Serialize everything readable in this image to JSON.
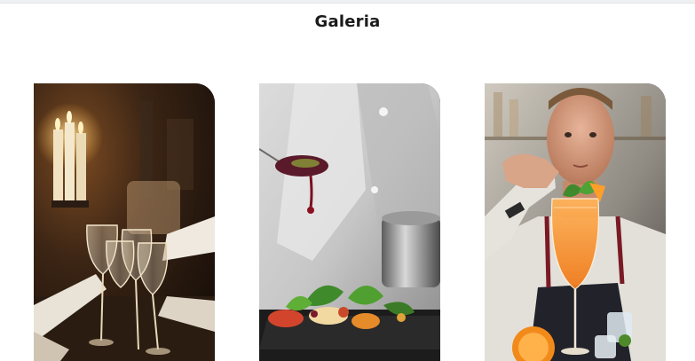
{
  "gallery": {
    "title": "Galeria",
    "images": [
      {
        "icon": "candlelit-toast-photo"
      },
      {
        "icon": "chef-plating-dish-photo"
      },
      {
        "icon": "bartender-cocktail-photo"
      }
    ]
  },
  "colors": {
    "background": "#ffffff",
    "title_text": "#1b1b1b"
  }
}
